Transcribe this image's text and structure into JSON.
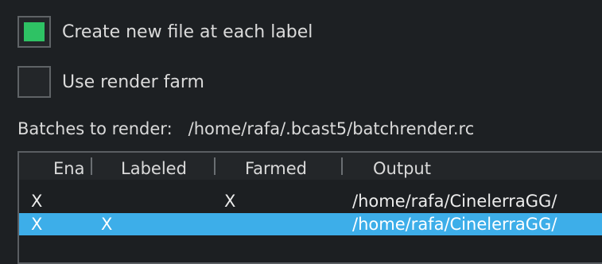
{
  "options": {
    "create_new_file": {
      "label": "Create new file at each label",
      "checked": true
    },
    "use_render_farm": {
      "label": "Use render farm",
      "checked": false
    }
  },
  "batches": {
    "label": "Batches to render:",
    "path": "/home/rafa/.bcast5/batchrender.rc"
  },
  "list": {
    "columns": [
      "Ena",
      "Labeled",
      "Farmed",
      "Output"
    ],
    "rows": [
      {
        "enabled": "X",
        "labeled": "",
        "farmed": "X",
        "output": "/home/rafa/CinelerraGG/",
        "selected": false
      },
      {
        "enabled": "X",
        "labeled": "X",
        "farmed": "",
        "output": "/home/rafa/CinelerraGG/",
        "selected": true
      }
    ]
  },
  "colors": {
    "check_mark": "#2ec264",
    "selection": "#3daee9",
    "background": "#1d2023"
  }
}
